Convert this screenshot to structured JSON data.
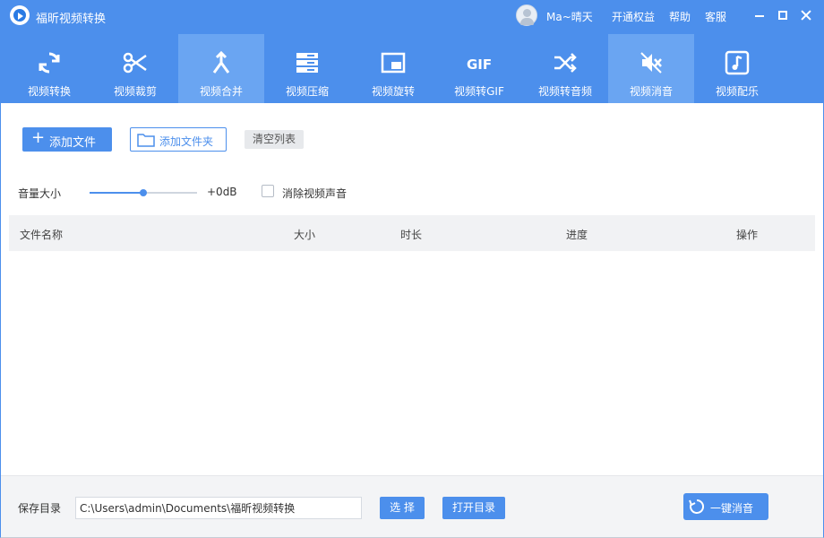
{
  "titlebar": {
    "app_title": "福昕视频转换",
    "user_name": "Ma~晴天",
    "links": {
      "vip": "开通权益",
      "help": "帮助",
      "service": "客服"
    }
  },
  "tabs": [
    {
      "label": "视频转换",
      "icon": "convert-icon",
      "active": false
    },
    {
      "label": "视频裁剪",
      "icon": "scissors-icon",
      "active": false
    },
    {
      "label": "视频合并",
      "icon": "merge-icon",
      "active": true
    },
    {
      "label": "视频压缩",
      "icon": "compress-icon",
      "active": false
    },
    {
      "label": "视频旋转",
      "icon": "rotate-icon",
      "active": false
    },
    {
      "label": "视频转GIF",
      "icon": "gif-icon",
      "active": false
    },
    {
      "label": "视频转音频",
      "icon": "shuffle-icon",
      "active": false
    },
    {
      "label": "视频消音",
      "icon": "mute-icon",
      "active": true
    },
    {
      "label": "视频配乐",
      "icon": "music-icon",
      "active": false
    }
  ],
  "toolbar": {
    "add_file": "添加文件",
    "add_folder": "添加文件夹",
    "clear_list": "清空列表"
  },
  "volume": {
    "label": "音量大小",
    "value_text": "+0dB",
    "level": 0.5,
    "mute_checkbox_label": "消除视频声音",
    "mute_checked": false
  },
  "table": {
    "columns": {
      "name": "文件名称",
      "size": "大小",
      "duration": "时长",
      "progress": "进度",
      "action": "操作"
    },
    "rows": []
  },
  "footer": {
    "save_label": "保存目录",
    "save_path": "C:\\Users\\admin\\Documents\\福昕视频转换",
    "select_button": "选 择",
    "open_dir_button": "打开目录",
    "mute_button": "一键消音"
  },
  "colors": {
    "brand": "#4c8fec",
    "active_tab": "#6aa5f2",
    "table_header_bg": "#f1f2f4",
    "footer_bg": "#f3f4f6"
  }
}
